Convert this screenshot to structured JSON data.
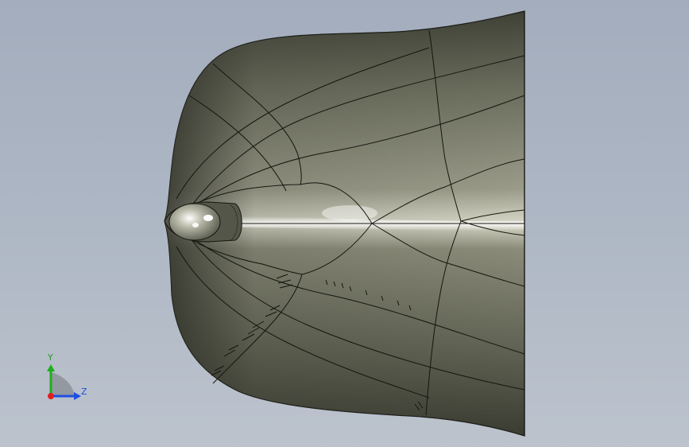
{
  "viewport": {
    "background_top": "#a3adbd",
    "background_bottom": "#bcc3cd",
    "model_color": "#6e7061"
  },
  "triad": {
    "y_label": "Y",
    "z_label": "Z",
    "colors": {
      "y": "#1fae1f",
      "z": "#1f4fe0",
      "x": "#e02020"
    }
  }
}
